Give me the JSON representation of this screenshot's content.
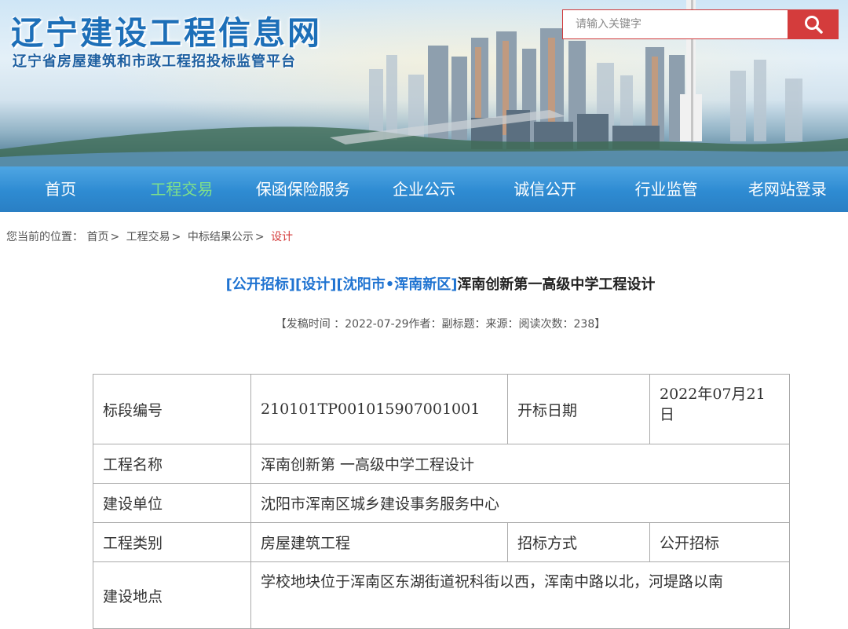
{
  "site": {
    "title": "辽宁建设工程信息网",
    "subtitle": "辽宁省房屋建筑和市政工程招投标监管平台"
  },
  "search": {
    "placeholder": "请输入关键字",
    "icon": "search-icon"
  },
  "colors": {
    "nav_bg": "#2e8bd2",
    "nav_active": "#7fe08a",
    "accent_red": "#d43c3c",
    "tag_blue": "#1f73d1"
  },
  "nav": {
    "items": [
      {
        "label": "首页",
        "active": false
      },
      {
        "label": "工程交易",
        "active": true
      },
      {
        "label": "保函保险服务",
        "active": false
      },
      {
        "label": "企业公示",
        "active": false
      },
      {
        "label": "诚信公开",
        "active": false
      },
      {
        "label": "行业监管",
        "active": false
      },
      {
        "label": "老网站登录",
        "active": false
      }
    ]
  },
  "breadcrumb": {
    "prefix": "您当前的位置：",
    "items": [
      "首页",
      "工程交易",
      "中标结果公示"
    ],
    "separator": ">",
    "current": "设计"
  },
  "article": {
    "tags": [
      "[公开招标]",
      "[设计]",
      "[沈阳市•浑南新区]"
    ],
    "title": "浑南创新第一高级中学工程设计",
    "meta": "【发稿时间 ：2022-07-29作者：副标题：来源：阅读次数：238】"
  },
  "table": {
    "section_no_label": "标段编号",
    "section_no": "210101TP001015907001001",
    "open_date_label": "开标日期",
    "open_date": "2022年07月21日",
    "project_name_label": "工程名称",
    "project_name": "浑南创新第 一高级中学工程设计",
    "builder_label": "建设单位",
    "builder": "沈阳市浑南区城乡建设事务服务中心",
    "category_label": "工程类别",
    "category": "房屋建筑工程",
    "bid_method_label": "招标方式",
    "bid_method": "公开招标",
    "location_label": "建设地点",
    "location": "学校地块位于浑南区东湖街道祝科街以西，浑南中路以北，河堤路以南"
  }
}
